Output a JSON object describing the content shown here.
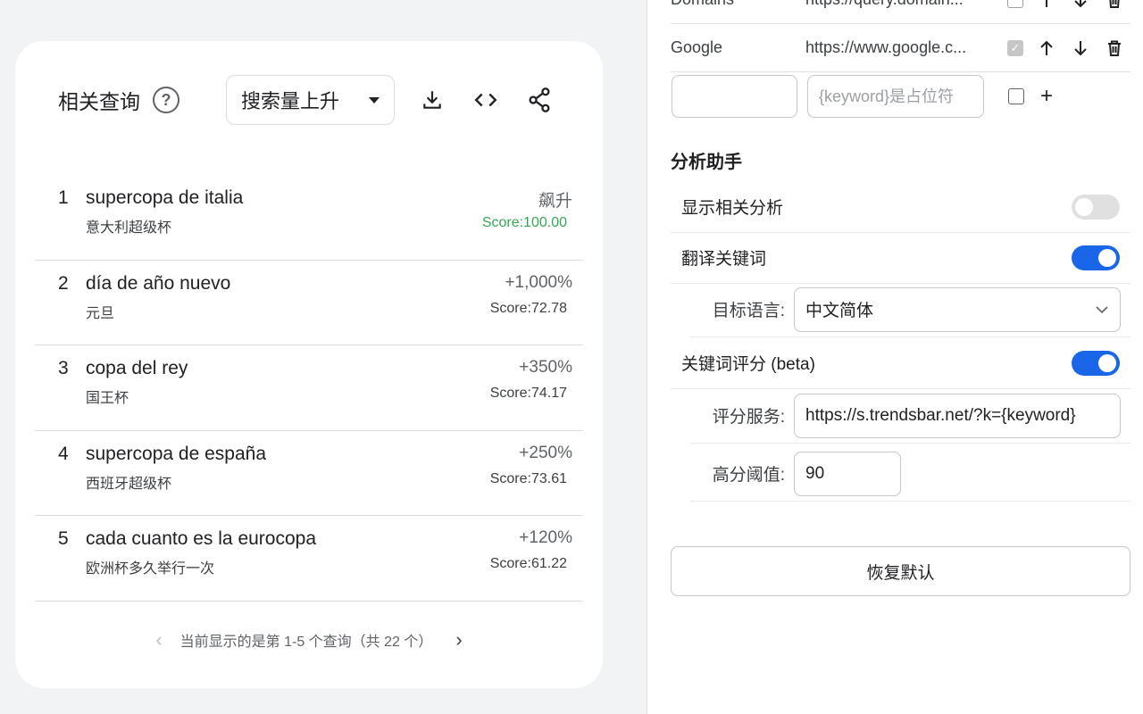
{
  "related": {
    "title": "相关查询",
    "sort_label": "搜索量上升",
    "items": [
      {
        "index": "1",
        "term": "supercopa de italia",
        "translation": "意大利超级杯",
        "change": "飙升",
        "score": "Score:100.00"
      },
      {
        "index": "2",
        "term": "día de año nuevo",
        "translation": "元旦",
        "change": "+1,000%",
        "score": "Score:72.78"
      },
      {
        "index": "3",
        "term": "copa del rey",
        "translation": "国王杯",
        "change": "+350%",
        "score": "Score:74.17"
      },
      {
        "index": "4",
        "term": "supercopa de españa",
        "translation": "西班牙超级杯",
        "change": "+250%",
        "score": "Score:73.61"
      },
      {
        "index": "5",
        "term": "cada cuanto es la eurocopa",
        "translation": "欧洲杯多久举行一次",
        "change": "+120%",
        "score": "Score:61.22"
      }
    ],
    "pager_text": "当前显示的是第 1-5 个查询（共 22 个）",
    "colors": {
      "score_top": "#34a853"
    }
  },
  "settings": {
    "engines": [
      {
        "name": "Domains",
        "url": "https://query.domain..."
      },
      {
        "name": "Google",
        "url": "https://www.google.c..."
      }
    ],
    "new_engine": {
      "name_value": "",
      "url_placeholder": "{keyword}是占位符"
    },
    "section_title": "分析助手",
    "show_related": {
      "label": "显示相关分析",
      "on": false
    },
    "translate": {
      "label": "翻译关键词",
      "on": true
    },
    "target_lang": {
      "label": "目标语言:",
      "value": "中文简体"
    },
    "keyword_score": {
      "label": "关键词评分 (beta)",
      "on": true
    },
    "score_service": {
      "label": "评分服务:",
      "value": "https://s.trendsbar.net/?k={keyword}"
    },
    "threshold": {
      "label": "高分阈值:",
      "value": "90"
    },
    "reset_label": "恢复默认",
    "colors": {
      "toggle_on": "#1a66e8"
    }
  }
}
